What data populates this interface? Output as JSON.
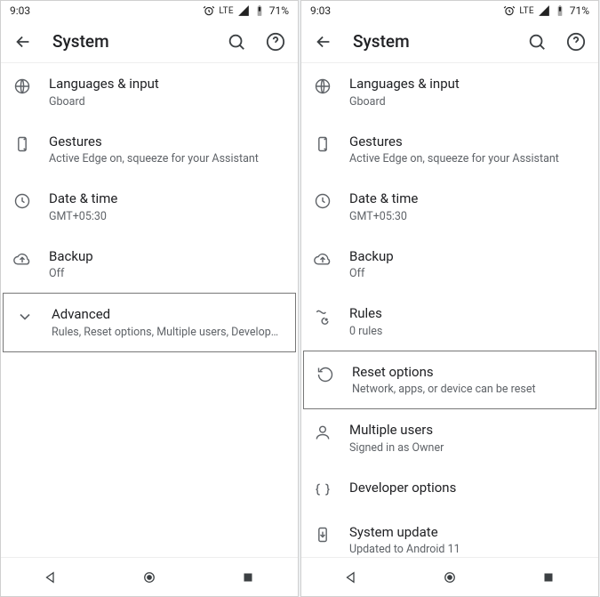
{
  "status": {
    "time": "9:03",
    "net": "LTE",
    "battery": "71%"
  },
  "appbar": {
    "title": "System"
  },
  "left": {
    "items": [
      {
        "title": "Languages & input",
        "sub": "Gboard"
      },
      {
        "title": "Gestures",
        "sub": "Active Edge on, squeeze for your Assistant"
      },
      {
        "title": "Date & time",
        "sub": "GMT+05:30"
      },
      {
        "title": "Backup",
        "sub": "Off"
      },
      {
        "title": "Advanced",
        "sub": "Rules, Reset options, Multiple users, Developer option.."
      }
    ]
  },
  "right": {
    "items": [
      {
        "title": "Languages & input",
        "sub": "Gboard"
      },
      {
        "title": "Gestures",
        "sub": "Active Edge on, squeeze for your Assistant"
      },
      {
        "title": "Date & time",
        "sub": "GMT+05:30"
      },
      {
        "title": "Backup",
        "sub": "Off"
      },
      {
        "title": "Rules",
        "sub": "0 rules"
      },
      {
        "title": "Reset options",
        "sub": "Network, apps, or device can be reset"
      },
      {
        "title": "Multiple users",
        "sub": "Signed in as Owner"
      },
      {
        "title": "Developer options",
        "sub": ""
      },
      {
        "title": "System update",
        "sub": "Updated to Android 11"
      }
    ]
  }
}
